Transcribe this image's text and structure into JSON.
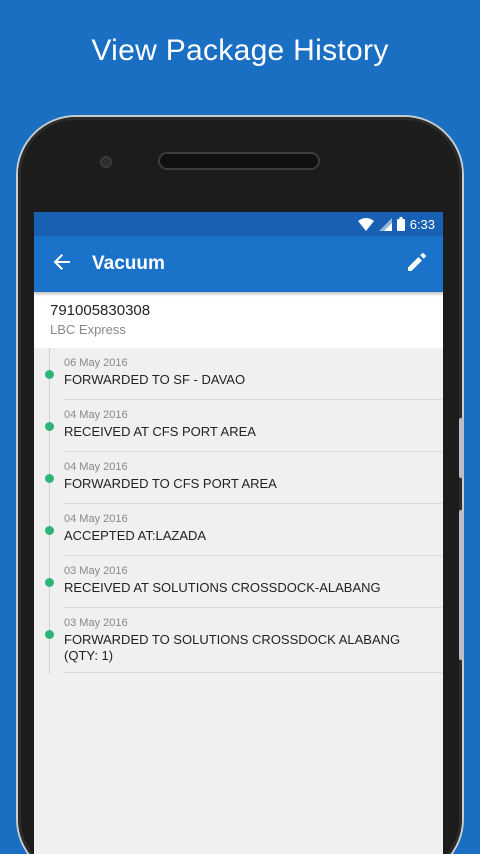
{
  "promo": {
    "headline": "View Package History"
  },
  "status_bar": {
    "time": "6:33"
  },
  "app_bar": {
    "title": "Vacuum"
  },
  "package": {
    "tracking_number": "791005830308",
    "courier": "LBC Express"
  },
  "events": [
    {
      "date": "06 May 2016",
      "description": "FORWARDED TO SF - DAVAO"
    },
    {
      "date": "04 May 2016",
      "description": "RECEIVED AT CFS PORT AREA"
    },
    {
      "date": "04 May 2016",
      "description": "FORWARDED TO CFS PORT AREA"
    },
    {
      "date": "04 May 2016",
      "description": "ACCEPTED AT:LAZADA"
    },
    {
      "date": "03 May 2016",
      "description": "RECEIVED AT SOLUTIONS CROSSDOCK-ALABANG"
    },
    {
      "date": "03 May 2016",
      "description": "FORWARDED TO SOLUTIONS CROSSDOCK ALABANG (QTY: 1)"
    }
  ],
  "icons": {
    "back": "arrow-left-icon",
    "edit": "pencil-icon",
    "wifi": "wifi-icon",
    "signal": "signal-icon",
    "battery": "battery-icon"
  },
  "colors": {
    "background": "#1a6fc2",
    "app_bar": "#1b73c9",
    "status_bar": "#1760b3",
    "timeline_dot": "#2bb673"
  }
}
